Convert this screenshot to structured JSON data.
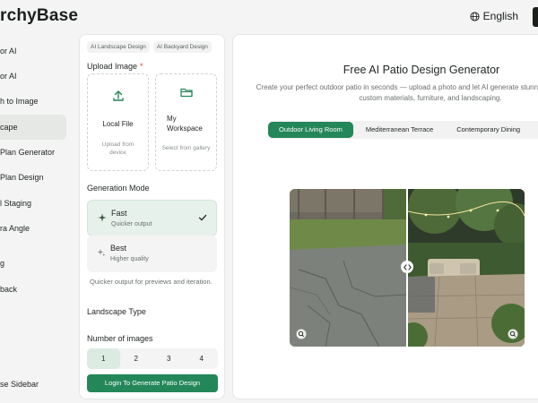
{
  "header": {
    "brand": "rchyBase",
    "language": "English"
  },
  "sidebar": {
    "items": [
      {
        "label": "or AI"
      },
      {
        "label": "or AI"
      },
      {
        "label": "h to Image"
      },
      {
        "label": "cape"
      },
      {
        "label": "Plan Generator"
      },
      {
        "label": "Plan Design"
      },
      {
        "label": "l Staging"
      },
      {
        "label": "ra Angle"
      },
      {
        "label": "g"
      },
      {
        "label": "back"
      }
    ],
    "collapse_label": "se Sidebar"
  },
  "panel": {
    "chips": [
      "AI Landscape Design",
      "AI Backyard Design"
    ],
    "upload_label": "Upload Image",
    "required_mark": "*",
    "local_file": {
      "title": "Local File",
      "subtitle": "Upload from device"
    },
    "workspace": {
      "title": "My Workspace",
      "subtitle": "Select from gallery"
    },
    "generation_mode_label": "Generation Mode",
    "modes": [
      {
        "title": "Fast",
        "subtitle": "Quicker output"
      },
      {
        "title": "Best",
        "subtitle": "Higher quality"
      }
    ],
    "mode_hint": "Quicker output for previews and iteration.",
    "landscape_type_label": "Landscape Type",
    "num_images_label": "Number of images",
    "num_options": [
      "1",
      "2",
      "3",
      "4"
    ],
    "cta": "Login To Generate Patio Design"
  },
  "main": {
    "title": "Free AI Patio Design Generator",
    "subtitle": "Create your perfect outdoor patio in seconds — upload a photo and let AI generate stunning patio layouts with custom materials, furniture, and landscaping.",
    "tabs": [
      "Outdoor Living Room",
      "Mediterranean Terrace",
      "Contemporary Dining"
    ]
  },
  "colors": {
    "accent": "#24875a",
    "selected_bg": "#e7f1eb"
  }
}
